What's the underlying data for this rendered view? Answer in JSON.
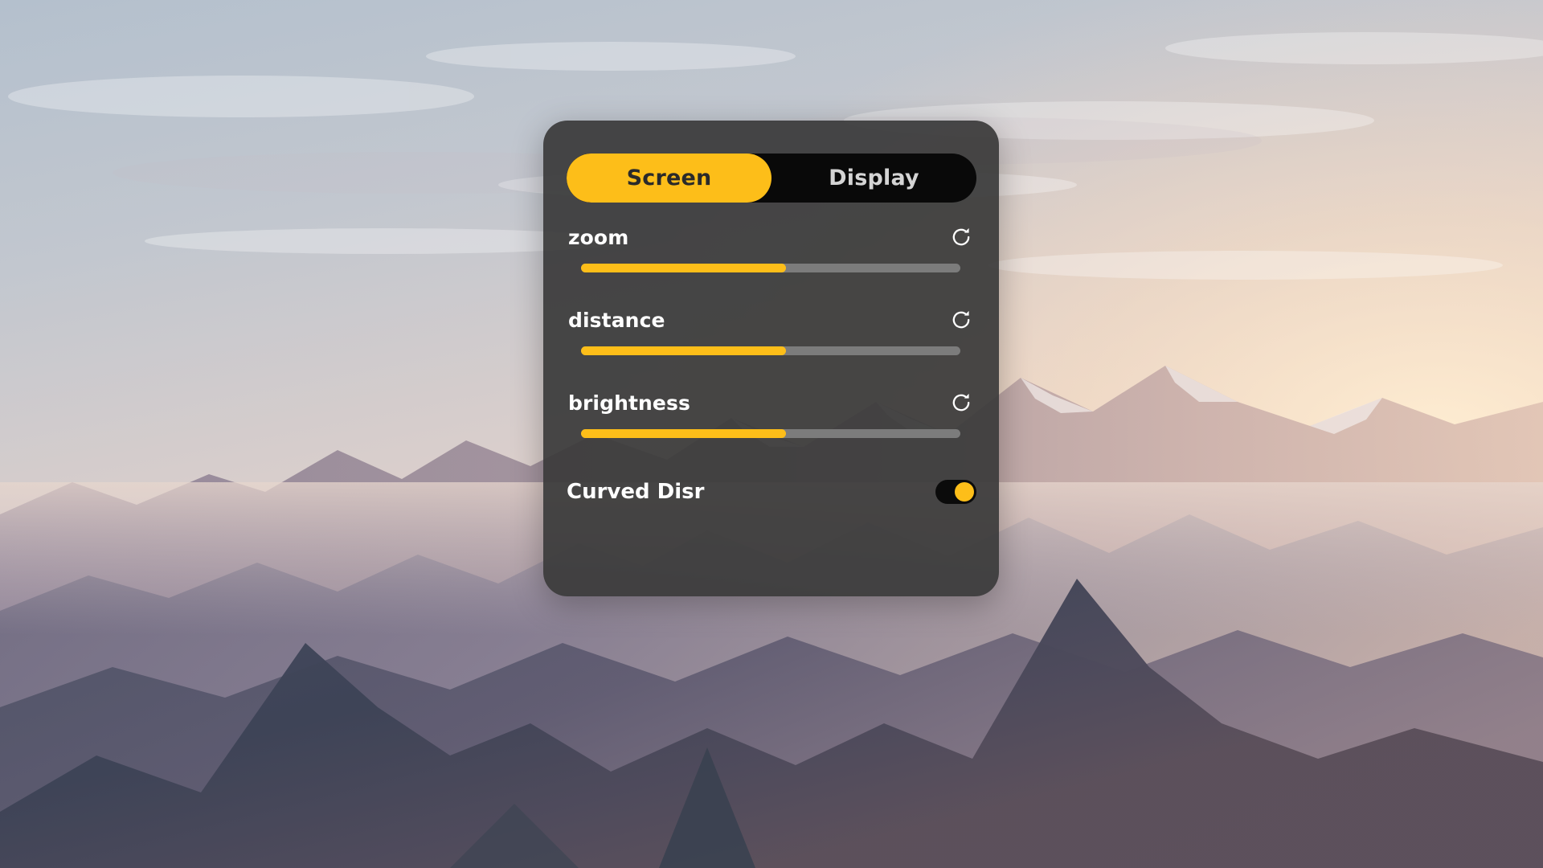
{
  "wallpaper": {
    "description": "sunset mountain landscape",
    "sky_top_color": "#b7c2ce",
    "sky_haze_color": "#d8cfcd",
    "sun_glow_color": "#fbe3c8",
    "ridge_far_color": "#9d8c9b",
    "ridge_mid_color": "#7e7489",
    "ridge_near_color": "#5b5a6e",
    "foreground_color": "#454a5c"
  },
  "panel": {
    "background_color": "#3a3a3a",
    "accent_color": "#fdbe19",
    "tabs": [
      {
        "label": "Screen",
        "active": true
      },
      {
        "label": "Display",
        "active": false
      }
    ],
    "sliders": [
      {
        "name": "zoom",
        "label": "zoom",
        "value": 54,
        "min": 0,
        "max": 100,
        "reset_icon": "refresh-icon"
      },
      {
        "name": "distance",
        "label": "distance",
        "value": 54,
        "min": 0,
        "max": 100,
        "reset_icon": "refresh-icon"
      },
      {
        "name": "brightness",
        "label": "brightness",
        "value": 54,
        "min": 0,
        "max": 100,
        "reset_icon": "refresh-icon"
      }
    ],
    "toggle": {
      "label": "Curved Disr",
      "state": "on",
      "state_label": "On"
    }
  }
}
